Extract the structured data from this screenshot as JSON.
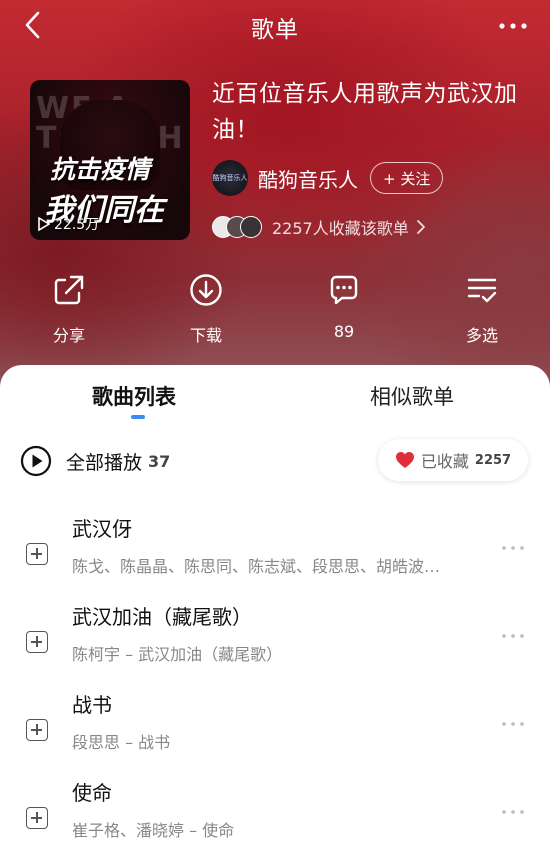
{
  "header": {
    "title": "歌单"
  },
  "playlist": {
    "title": "近百位音乐人用歌声为武汉加油！",
    "cover": {
      "line1": "抗击疫情",
      "line2": "我们同在",
      "background_text": "WE A TOGETH",
      "play_count": "22.5万"
    },
    "creator": {
      "name": "酷狗音乐人",
      "avatar_text": "酷狗音乐人"
    },
    "follow_label": "+ 关注",
    "collectors_text": "2257人收藏该歌单"
  },
  "actions": [
    {
      "label": "分享",
      "icon": "share-icon"
    },
    {
      "label": "下载",
      "icon": "download-icon"
    },
    {
      "label": "89",
      "icon": "comment-icon"
    },
    {
      "label": "多选",
      "icon": "multi-select-icon"
    }
  ],
  "tabs": [
    {
      "label": "歌曲列表",
      "active": true
    },
    {
      "label": "相似歌单",
      "active": false
    }
  ],
  "play_all": {
    "label": "全部播放",
    "count": "37"
  },
  "collected": {
    "label": "已收藏",
    "count": "2257",
    "color": "#e02e3b"
  },
  "songs": [
    {
      "title": "武汉伢",
      "artist": "陈戈、陈晶晶、陈思同、陈志斌、段思思、胡皓波…"
    },
    {
      "title": "武汉加油（藏尾歌）",
      "artist": "陈柯宇 – 武汉加油（藏尾歌）"
    },
    {
      "title": "战书",
      "artist": "段思思 – 战书"
    },
    {
      "title": "使命",
      "artist": "崔子格、潘晓婷 – 使命"
    }
  ],
  "colors": {
    "accent": "#3b8bf5",
    "hero": "#b3232c"
  }
}
